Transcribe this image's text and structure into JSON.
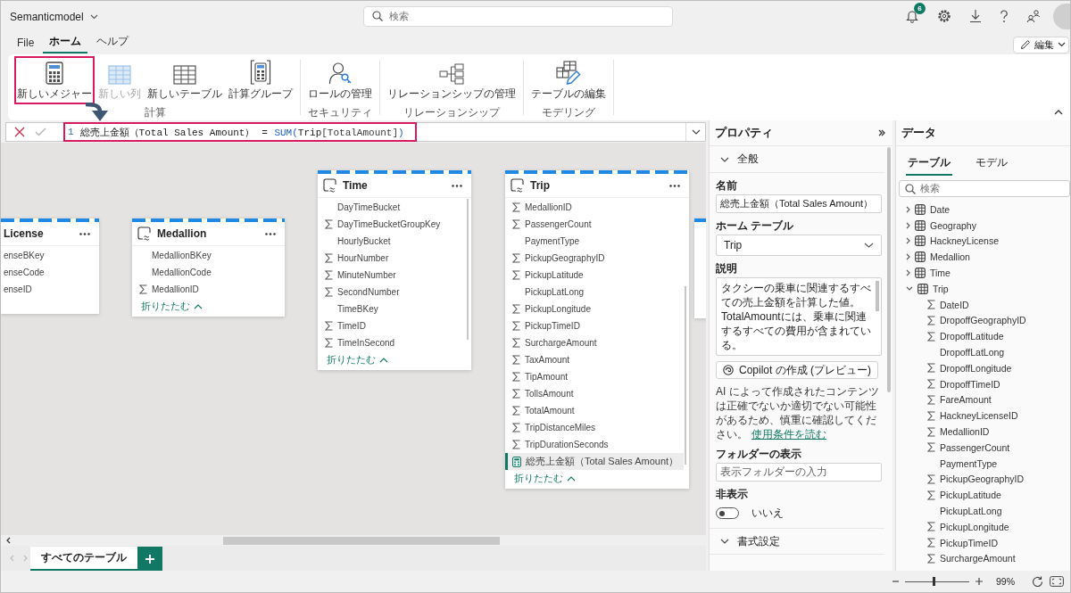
{
  "app_bar": {
    "title": "Semanticmodel",
    "search": {
      "placeholder": "検索"
    },
    "notification_badge": "6"
  },
  "ribbon": {
    "tabs": [
      {
        "label": "File",
        "selected": false
      },
      {
        "label": "ホーム",
        "selected": true
      },
      {
        "label": "ヘルプ",
        "selected": false
      }
    ],
    "edit_button": {
      "label": "編集"
    },
    "groups": [
      {
        "label": "計算",
        "buttons": [
          {
            "label": "新しいメジャー",
            "disabled": false,
            "highlighted": true
          },
          {
            "label": "新しい列",
            "disabled": true,
            "highlighted": false
          },
          {
            "label": "新しいテーブル",
            "disabled": false,
            "highlighted": false
          },
          {
            "label": "計算グループ",
            "disabled": false,
            "highlighted": false
          }
        ]
      },
      {
        "label": "セキュリティ",
        "buttons": [
          {
            "label": "ロールの管理",
            "disabled": false,
            "highlighted": false
          }
        ]
      },
      {
        "label": "リレーションシップ",
        "buttons": [
          {
            "label": "リレーションシップの管理",
            "disabled": false,
            "highlighted": false
          }
        ]
      },
      {
        "label": "モデリング",
        "buttons": [
          {
            "label": "テーブルの編集",
            "disabled": false,
            "highlighted": false
          }
        ]
      }
    ]
  },
  "formula_bar": {
    "highlighted": true,
    "line_number": "1",
    "tokens": [
      {
        "text": "総売上金額（Total Sales Amount）",
        "kind": "name"
      },
      {
        "text": "=",
        "kind": "operator"
      },
      {
        "text": "SUM",
        "kind": "function"
      },
      {
        "text": "(",
        "kind": "paren"
      },
      {
        "text": "Trip",
        "kind": "name"
      },
      {
        "text": "[TotalAmount]",
        "kind": "column"
      },
      {
        "text": ")",
        "kind": "paren"
      }
    ]
  },
  "canvas": {
    "tables": [
      {
        "name": "License",
        "columns": [
          {
            "name": "enseBKey",
            "selected": false
          },
          {
            "name": "enseCode",
            "selected": false
          },
          {
            "name": "enseID",
            "selected": false
          }
        ]
      },
      {
        "name": "Medallion",
        "columns": [
          {
            "name": "MedallionBKey",
            "kind": "plain",
            "selected": false
          },
          {
            "name": "MedallionCode",
            "kind": "plain",
            "selected": false
          },
          {
            "name": "MedallionID",
            "kind": "sum",
            "selected": false
          }
        ],
        "collapse_label": "折りたたむ"
      },
      {
        "name": "Time",
        "columns": [
          {
            "name": "DayTimeBucket",
            "kind": "plain",
            "selected": false
          },
          {
            "name": "DayTimeBucketGroupKey",
            "kind": "sum",
            "selected": false
          },
          {
            "name": "HourlyBucket",
            "kind": "plain",
            "selected": false
          },
          {
            "name": "HourNumber",
            "kind": "sum",
            "selected": false
          },
          {
            "name": "MinuteNumber",
            "kind": "sum",
            "selected": false
          },
          {
            "name": "SecondNumber",
            "kind": "sum",
            "selected": false
          },
          {
            "name": "TimeBKey",
            "kind": "plain",
            "selected": false
          },
          {
            "name": "TimeID",
            "kind": "sum",
            "selected": false
          },
          {
            "name": "TimeInSecond",
            "kind": "sum",
            "selected": false
          }
        ],
        "collapse_label": "折りたたむ"
      },
      {
        "name": "Trip",
        "columns": [
          {
            "name": "MedallionID",
            "kind": "sum",
            "selected": false
          },
          {
            "name": "PassengerCount",
            "kind": "sum",
            "selected": false
          },
          {
            "name": "PaymentType",
            "kind": "plain",
            "selected": false
          },
          {
            "name": "PickupGeographyID",
            "kind": "sum",
            "selected": false
          },
          {
            "name": "PickupLatitude",
            "kind": "sum",
            "selected": false
          },
          {
            "name": "PickupLatLong",
            "kind": "plain",
            "selected": false
          },
          {
            "name": "PickupLongitude",
            "kind": "sum",
            "selected": false
          },
          {
            "name": "PickupTimeID",
            "kind": "sum",
            "selected": false
          },
          {
            "name": "SurchargeAmount",
            "kind": "sum",
            "selected": false
          },
          {
            "name": "TaxAmount",
            "kind": "sum",
            "selected": false
          },
          {
            "name": "TipAmount",
            "kind": "sum",
            "selected": false
          },
          {
            "name": "TollsAmount",
            "kind": "sum",
            "selected": false
          },
          {
            "name": "TotalAmount",
            "kind": "sum",
            "selected": false
          },
          {
            "name": "TripDistanceMiles",
            "kind": "sum",
            "selected": false
          },
          {
            "name": "TripDurationSeconds",
            "kind": "sum",
            "selected": false
          },
          {
            "name": "総売上金額（Total Sales Amount）",
            "kind": "measure",
            "selected": true
          }
        ],
        "collapse_label": "折りたたむ"
      }
    ],
    "page_tabs": [
      {
        "label": "すべてのテーブル",
        "selected": true
      }
    ]
  },
  "properties": {
    "title": "プロパティ",
    "general": {
      "label": "全般",
      "name_field": {
        "label": "名前",
        "value": "総売上金額（Total Sales Amount）"
      },
      "home_table": {
        "label": "ホーム テーブル",
        "value": "Trip"
      },
      "description": {
        "label": "説明",
        "value": "タクシーの乗車に関連するすべての売上金額を計算した値。TotalAmountには、乗車に関連するすべての費用が含まれている。"
      },
      "copilot_button": {
        "label": "Copilot の作成 (プレビュー)"
      },
      "disclaimer": {
        "text": "AI によって作成されたコンテンツは正確でないか適切でない可能性があるため、慎重に確認してください。",
        "link": "使用条件を読む"
      },
      "display_folder": {
        "label": "フォルダーの表示",
        "placeholder": "表示フォルダーの入力"
      },
      "hidden": {
        "label": "非表示",
        "on": false,
        "state_label": "いいえ"
      }
    },
    "formatting": {
      "label": "書式設定"
    }
  },
  "data": {
    "title": "データ",
    "tabs": [
      {
        "label": "テーブル",
        "selected": true
      },
      {
        "label": "モデル",
        "selected": false
      }
    ],
    "search": {
      "placeholder": "検索"
    },
    "tables": [
      {
        "name": "Date",
        "expanded": false
      },
      {
        "name": "Geography",
        "expanded": false
      },
      {
        "name": "HackneyLicense",
        "expanded": false
      },
      {
        "name": "Medallion",
        "expanded": false
      },
      {
        "name": "Time",
        "expanded": false
      },
      {
        "name": "Trip",
        "expanded": true,
        "children": [
          {
            "name": "DateID",
            "kind": "sum"
          },
          {
            "name": "DropoffGeographyID",
            "kind": "sum"
          },
          {
            "name": "DropoffLatitude",
            "kind": "sum"
          },
          {
            "name": "DropoffLatLong",
            "kind": "plain"
          },
          {
            "name": "DropoffLongitude",
            "kind": "sum"
          },
          {
            "name": "DropoffTimeID",
            "kind": "sum"
          },
          {
            "name": "FareAmount",
            "kind": "sum"
          },
          {
            "name": "HackneyLicenseID",
            "kind": "sum"
          },
          {
            "name": "MedallionID",
            "kind": "sum"
          },
          {
            "name": "PassengerCount",
            "kind": "sum"
          },
          {
            "name": "PaymentType",
            "kind": "plain"
          },
          {
            "name": "PickupGeographyID",
            "kind": "sum"
          },
          {
            "name": "PickupLatitude",
            "kind": "sum"
          },
          {
            "name": "PickupLatLong",
            "kind": "plain"
          },
          {
            "name": "PickupLongitude",
            "kind": "sum"
          },
          {
            "name": "PickupTimeID",
            "kind": "sum"
          },
          {
            "name": "SurchargeAmount",
            "kind": "sum"
          }
        ]
      }
    ]
  },
  "status_bar": {
    "zoom": {
      "level": 0.45,
      "reading": "99%"
    }
  }
}
